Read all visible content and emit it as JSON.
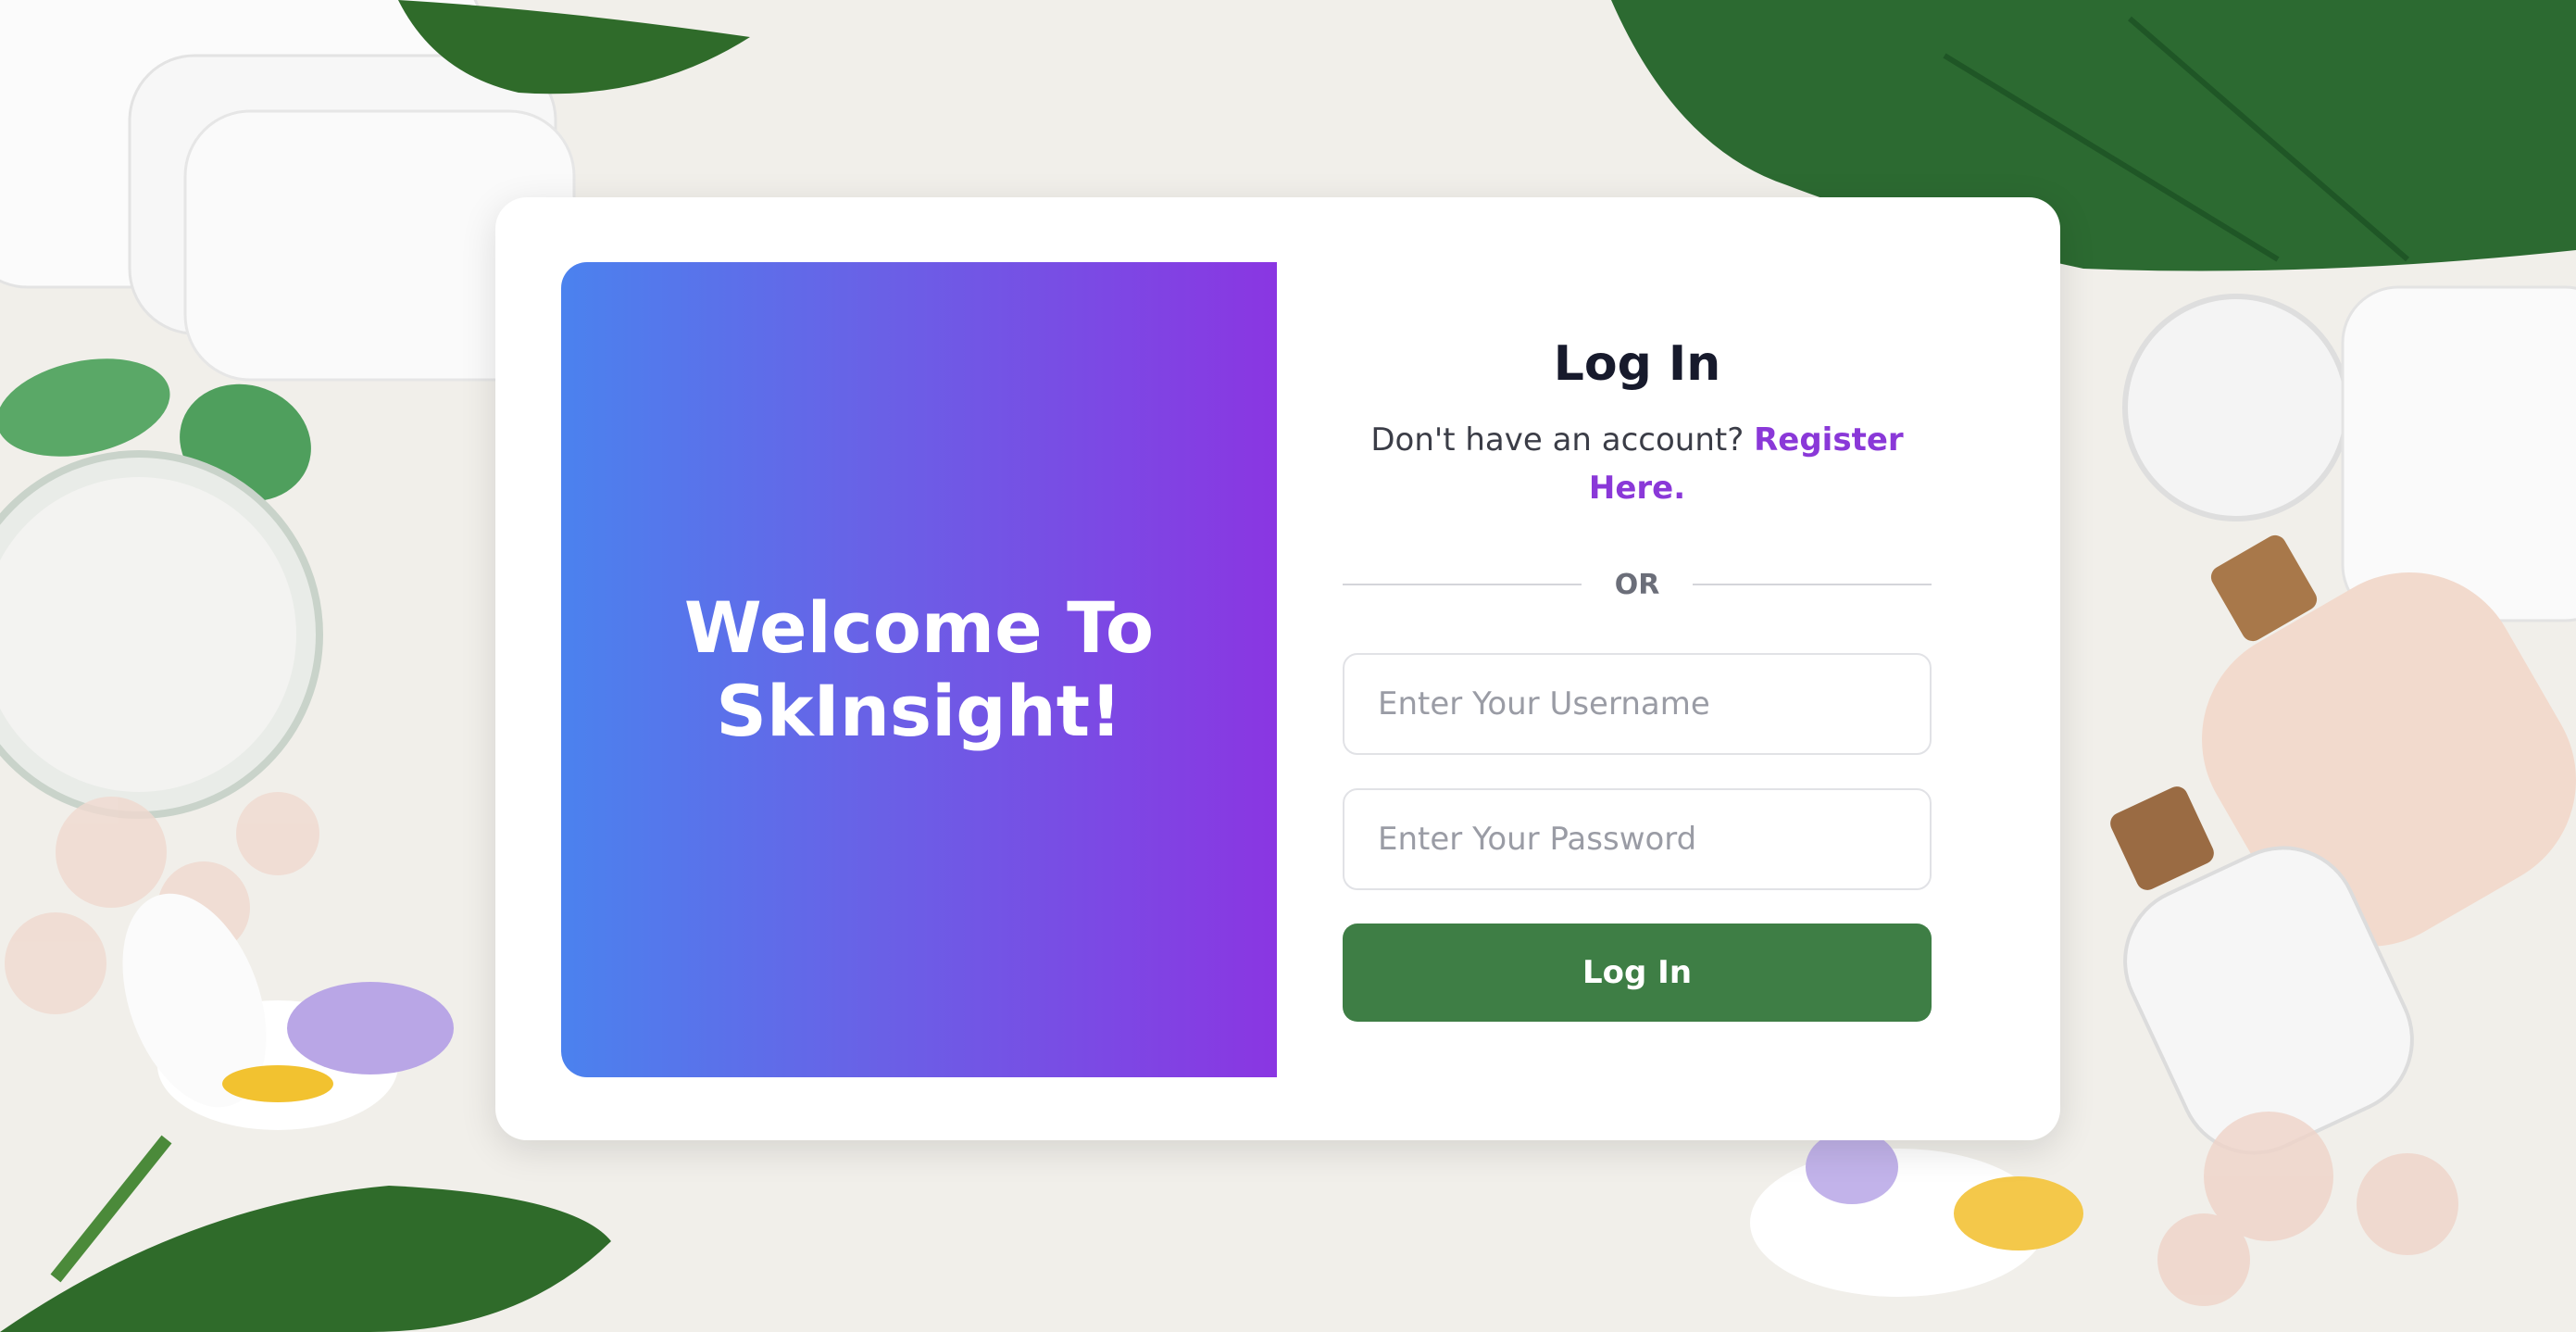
{
  "welcome": {
    "title": "Welcome To SkInsight!"
  },
  "login": {
    "title": "Log In",
    "no_account_text": "Don't have an account?",
    "register_link": "Register Here.",
    "divider_text": "OR",
    "username_placeholder": "Enter Your Username",
    "password_placeholder": "Enter Your Password",
    "submit_label": "Log In"
  },
  "colors": {
    "gradient_start": "#4b82ee",
    "gradient_end": "#8a36e2",
    "accent_link": "#8a38d8",
    "button": "#3e7e45",
    "background": "#f1efea"
  }
}
